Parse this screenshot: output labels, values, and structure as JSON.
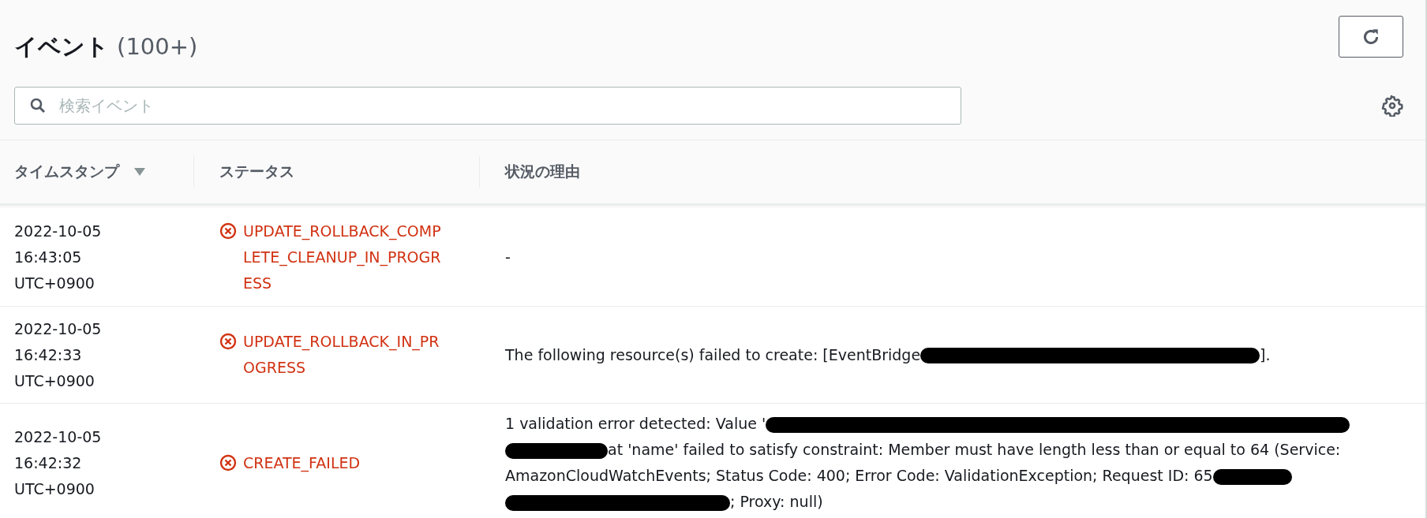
{
  "header": {
    "title": "イベント",
    "count": "(100+)"
  },
  "search": {
    "placeholder": "検索イベント"
  },
  "table": {
    "columns": [
      {
        "label": "タイムスタンプ",
        "sorted": true
      },
      {
        "label": "ステータス",
        "sorted": false
      },
      {
        "label": "状況の理由",
        "sorted": false
      }
    ],
    "rows": [
      {
        "timestamp": [
          "2022-10-05",
          "16:43:05",
          "UTC+0900"
        ],
        "status": {
          "kind": "failed",
          "label": "UPDATE_ROLLBACK_COMPLETE_CLEANUP_IN_PROGRESS"
        },
        "reason": [
          {
            "kind": "text",
            "text": "-"
          }
        ]
      },
      {
        "timestamp": [
          "2022-10-05",
          "16:42:33",
          "UTC+0900"
        ],
        "status": {
          "kind": "failed",
          "label": "UPDATE_ROLLBACK_IN_PROGRESS"
        },
        "reason": [
          {
            "kind": "text",
            "text": "The following resource(s) failed to create: [EventBridge"
          },
          {
            "kind": "redacted"
          },
          {
            "kind": "text",
            "text": "]."
          }
        ]
      },
      {
        "timestamp": [
          "2022-10-05",
          "16:42:32",
          "UTC+0900"
        ],
        "status": {
          "kind": "failed",
          "label": "CREATE_FAILED"
        },
        "reason": [
          {
            "kind": "text",
            "text": "1 validation error detected: Value '"
          },
          {
            "kind": "redacted"
          },
          {
            "kind": "redacted"
          },
          {
            "kind": "text",
            "text": "at 'name' failed to satisfy constraint: Member must have length less than or equal to 64 (Service:"
          },
          {
            "kind": "text",
            "text": "AmazonCloudWatchEvents; Status Code: 400; Error Code: ValidationException; Request ID: 65"
          },
          {
            "kind": "redacted"
          },
          {
            "kind": "redacted"
          },
          {
            "kind": "text",
            "text": "; Proxy: null)"
          }
        ]
      }
    ]
  }
}
